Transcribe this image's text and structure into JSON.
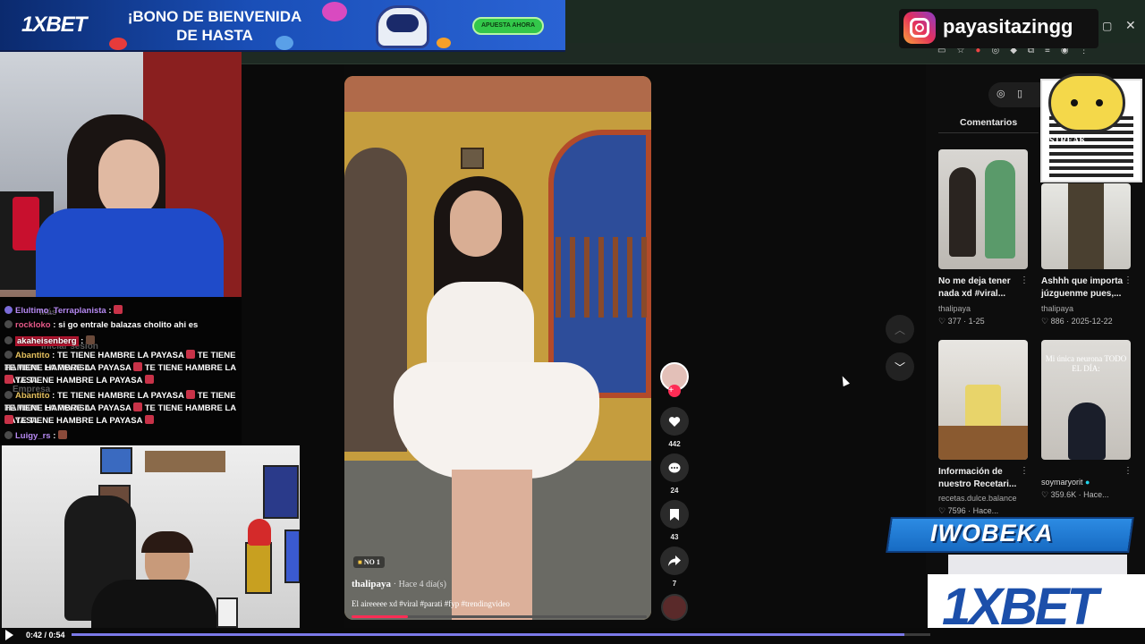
{
  "banner": {
    "brand": "1XBET",
    "headline_line1": "¡BONO DE BIENVENIDA",
    "headline_line2": "DE HASTA",
    "cta": "APUESTA AHORA"
  },
  "instagram": {
    "handle": "payasitazingg"
  },
  "ghost_text": {
    "login": "Iniciar sesión",
    "company": "Empresa",
    "more": "Más"
  },
  "chat": {
    "messages": [
      {
        "user": "Elultimo_Terraplanista",
        "text": ""
      },
      {
        "user": "rockloko",
        "text": "si go entrale balazas cholito ahi es"
      },
      {
        "user": "akaheisenberg",
        "text": ""
      },
      {
        "user": "Abantito",
        "text": "TE TIENE HAMBRE LA PAYASA",
        "repeat2": "TE TIENE HAMBRE LA PAYASA",
        "repeat3": "TE TIENE HAMBRE LA PAYASA",
        "repeat4": "TE TIENE HAMBRE LA PAYASA",
        "repeat5": "TE TIENE HAMBRE LA PAYASA"
      },
      {
        "user": "Abantito",
        "text": "TE TIENE HAMBRE LA PAYASA",
        "repeat2": "TE TIENE HAMBRE LA PAYASA",
        "repeat3": "TE TIENE HAMBRE LA PAYASA",
        "repeat4": "TE TIENE HAMBRE LA PAYASA",
        "repeat5": "TE TIENE HAMBRE LA PAYASA"
      },
      {
        "user": "Luigy_rs",
        "text": ""
      }
    ]
  },
  "player": {
    "time": "0:42 / 0:54",
    "progress": 0.97
  },
  "video": {
    "badge": "NO 1",
    "author": "thalipaya",
    "age": "· Hace 4 día(s)",
    "caption": "El aireeeee xd #viral #parati #fyp #trendingvideo",
    "progress": 0.19
  },
  "actions": {
    "likes": "442",
    "comments": "24",
    "saves": "43",
    "shares": "7"
  },
  "right_panel": {
    "tab": "Comentarios",
    "cards": [
      {
        "title": "No me deja tener nada xd #viral...",
        "author": "thalipaya",
        "views": "377",
        "date": "1-25"
      },
      {
        "title": "Ashhh que importa júzguenme pues,...",
        "author": "thalipaya",
        "views": "886",
        "date": "2025-12-22"
      },
      {
        "title": "Información de nuestro Recetari...",
        "author": "recetas.dulce.balance",
        "views": "7596",
        "date": "Hace..."
      },
      {
        "title": "",
        "author": "soymaryorit",
        "views": "359.6K",
        "date": "Hace...",
        "overlay": "Mi única neurona TODO EL DÍA:"
      }
    ]
  },
  "overlays": {
    "name_plate": "IWOBEKA",
    "brand_logo": "1XBET",
    "qr_caption": "STREAK"
  }
}
